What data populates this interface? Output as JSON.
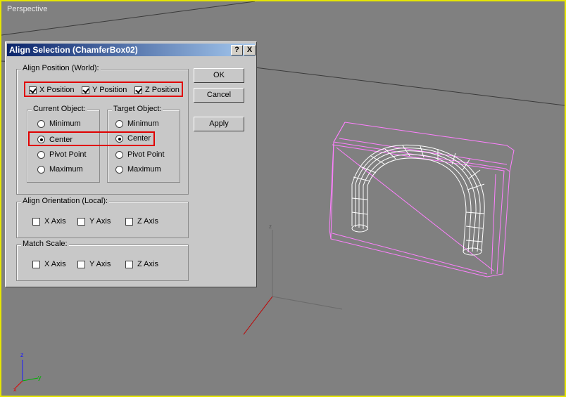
{
  "viewport": {
    "label": "Perspective"
  },
  "dialog": {
    "title": "Align Selection (ChamferBox02)",
    "help_label": "?",
    "close_label": "X",
    "align_position": {
      "group_title": "Align Position (World):",
      "x": {
        "label": "X Position",
        "checked": true
      },
      "y": {
        "label": "Y Position",
        "checked": true
      },
      "z": {
        "label": "Z Position",
        "checked": true
      }
    },
    "current_object": {
      "title": "Current Object:",
      "options": [
        "Minimum",
        "Center",
        "Pivot Point",
        "Maximum"
      ],
      "selected": "Center"
    },
    "target_object": {
      "title": "Target Object:",
      "options": [
        "Minimum",
        "Center",
        "Pivot Point",
        "Maximum"
      ],
      "selected": "Center"
    },
    "align_orientation": {
      "title": "Align Orientation (Local):",
      "x": "X Axis",
      "y": "Y Axis",
      "z": "Z Axis"
    },
    "match_scale": {
      "title": "Match Scale:",
      "x": "X Axis",
      "y": "Y Axis",
      "z": "Z Axis"
    },
    "buttons": {
      "ok": "OK",
      "cancel": "Cancel",
      "apply": "Apply"
    }
  },
  "axis_tripod": {
    "x": "x",
    "y": "y",
    "z": "z"
  },
  "colors": {
    "viewport_border": "#e6e600",
    "highlight": "#e00000",
    "wire_pink": "#ff80ff",
    "wire_white": "#ffffff"
  }
}
